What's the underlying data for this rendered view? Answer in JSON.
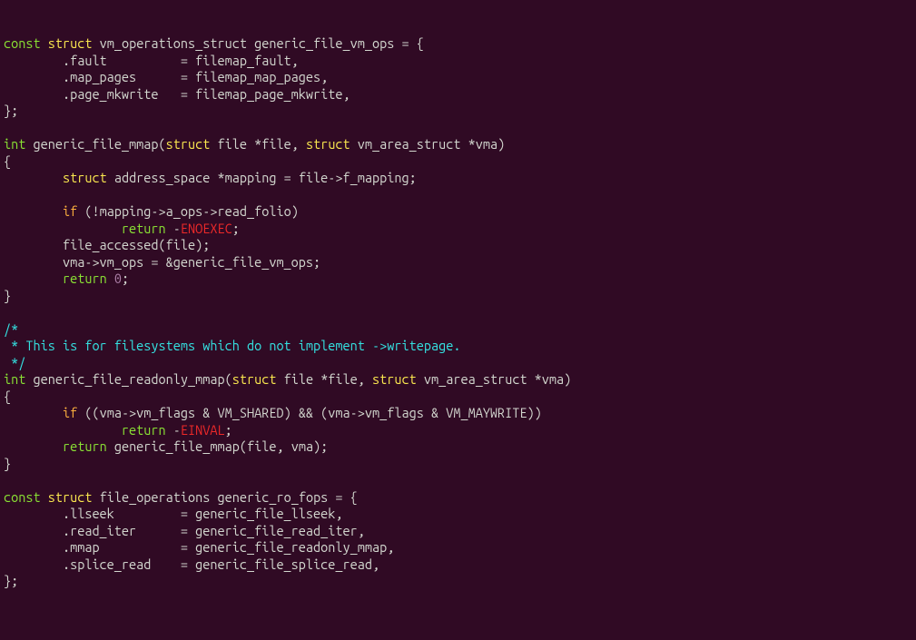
{
  "l1": {
    "a": "const",
    "b": "struct",
    "c": " vm_operations_struct generic_file_vm_ops = {"
  },
  "l2": {
    "a": "        .fault          = filemap_fault,"
  },
  "l3": {
    "a": "        .map_pages      = filemap_map_pages,"
  },
  "l4": {
    "a": "        .page_mkwrite   = filemap_page_mkwrite,"
  },
  "l5": {
    "a": "};"
  },
  "l6": {
    "a": ""
  },
  "l7": {
    "a": "int",
    "b": " generic_file_mmap(",
    "c": "struct",
    "d": " file *file, ",
    "e": "struct",
    "f": " vm_area_struct *vma)"
  },
  "l8": {
    "a": "{"
  },
  "l9": {
    "a": "        ",
    "b": "struct",
    "c": " address_space *mapping = file->f_mapping;"
  },
  "l10": {
    "a": ""
  },
  "l11": {
    "a": "        ",
    "b": "if",
    "c": " (!mapping->a_ops->read_folio)"
  },
  "l12": {
    "a": "                ",
    "b": "return",
    "c": " -",
    "d": "ENOEXEC",
    "e": ";"
  },
  "l13": {
    "a": "        file_accessed(file);"
  },
  "l14": {
    "a": "        vma->vm_ops = &generic_file_vm_ops;"
  },
  "l15": {
    "a": "        ",
    "b": "return",
    "c": " ",
    "d": "0",
    "e": ";"
  },
  "l16": {
    "a": "}"
  },
  "l17": {
    "a": ""
  },
  "l18": {
    "a": "/*"
  },
  "l19": {
    "a": " * This is for filesystems which do not implement ->writepage."
  },
  "l20": {
    "a": " */"
  },
  "l21": {
    "a": "int",
    "b": " generic_file_readonly_mmap(",
    "c": "struct",
    "d": " file *file, ",
    "e": "struct",
    "f": " vm_area_struct *vma)"
  },
  "l22": {
    "a": "{"
  },
  "l23": {
    "a": "        ",
    "b": "if",
    "c": " ((vma->vm_flags & VM_SHARED) && (vma->vm_flags & VM_MAYWRITE))"
  },
  "l24": {
    "a": "                ",
    "b": "return",
    "c": " -",
    "d": "EINVAL",
    "e": ";"
  },
  "l25": {
    "a": "        ",
    "b": "return",
    "c": " generic_file_mmap(file, vma);"
  },
  "l26": {
    "a": "}"
  },
  "l27": {
    "a": ""
  },
  "l28": {
    "a": "const",
    "b": "struct",
    "c": " file_operations generic_ro_fops = {"
  },
  "l29": {
    "a": "        .llseek         = generic_file_llseek,"
  },
  "l30": {
    "a": "        .read_iter      = generic_file_read_iter,"
  },
  "l31": {
    "a": "        .mmap           = generic_file_readonly_mmap,"
  },
  "l32": {
    "a": "        .splice_read    = generic_file_splice_read,"
  },
  "l33": {
    "a": "};"
  }
}
